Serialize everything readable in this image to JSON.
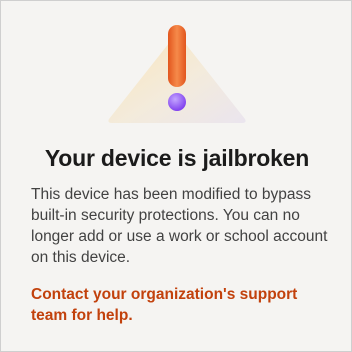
{
  "screen": {
    "title": "Your device is jailbroken",
    "body": "This device has been modified to bypass built-in security protections. You can no longer add or use a work or school account on this device.",
    "support_link": "Contact your organization's support team for help."
  },
  "icons": {
    "illustration": "warning-exclamation-illustration"
  },
  "colors": {
    "background": "#f5f4f2",
    "title": "#1b1b1b",
    "body": "#424242",
    "link": "#c2410c",
    "exclamation_bar": "#f26b2a",
    "exclamation_dot": "#8b5cf6"
  }
}
